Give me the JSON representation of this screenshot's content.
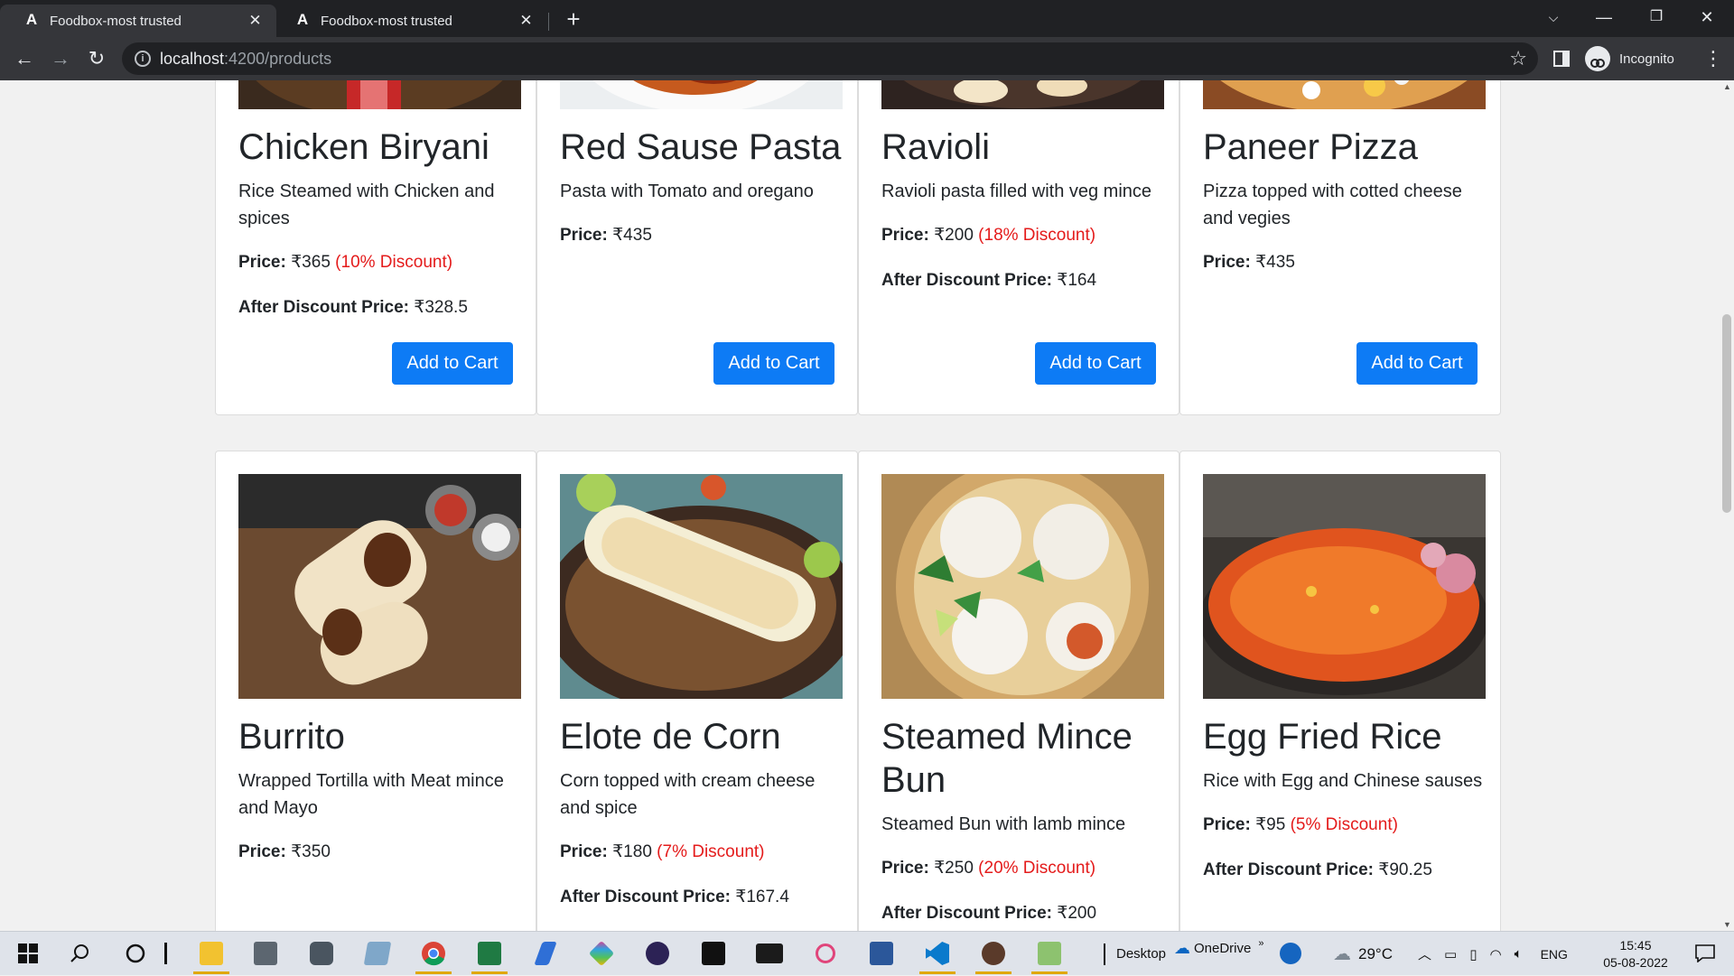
{
  "browser": {
    "tabs": [
      {
        "favicon": "A",
        "title": "Foodbox-most trusted",
        "active": true
      },
      {
        "favicon": "A",
        "title": "Foodbox-most trusted",
        "active": false
      }
    ],
    "new_tab": "+",
    "url_host": "localhost",
    "url_rest": ":4200/products",
    "profile_label": "Incognito",
    "icons": {
      "back": "back-arrow-icon",
      "forward": "forward-arrow-icon",
      "reload": "reload-icon",
      "star": "bookmark-star-icon",
      "menu": "kebab-menu-icon"
    }
  },
  "products": [
    {
      "name": "Chicken Biryani",
      "desc": "Rice Steamed with Chicken and spices",
      "price_label": "Price:",
      "price": "₹365",
      "discount": "(10% Discount)",
      "after_label": "After Discount Price:",
      "after_price": "₹328.5",
      "button": "Add to Cart"
    },
    {
      "name": "Red Sause Pasta",
      "desc": "Pasta with Tomato and oregano",
      "price_label": "Price:",
      "price": "₹435",
      "button": "Add to Cart"
    },
    {
      "name": "Ravioli",
      "desc": "Ravioli pasta filled with veg mince",
      "price_label": "Price:",
      "price": "₹200",
      "discount": "(18% Discount)",
      "after_label": "After Discount Price:",
      "after_price": "₹164",
      "button": "Add to Cart"
    },
    {
      "name": "Paneer Pizza",
      "desc": "Pizza topped with cotted cheese and vegies",
      "price_label": "Price:",
      "price": "₹435",
      "button": "Add to Cart"
    },
    {
      "name": "Burrito",
      "desc": "Wrapped Tortilla with Meat mince and Mayo",
      "price_label": "Price:",
      "price": "₹350"
    },
    {
      "name": "Elote de Corn",
      "desc": "Corn topped with cream cheese and spice",
      "price_label": "Price:",
      "price": "₹180",
      "discount": "(7% Discount)",
      "after_label": "After Discount Price:",
      "after_price": "₹167.4"
    },
    {
      "name": "Steamed Mince Bun",
      "desc": "Steamed Bun with lamb mince",
      "price_label": "Price:",
      "price": "₹250",
      "discount": "(20% Discount)",
      "after_label": "After Discount Price:",
      "after_price": "₹200"
    },
    {
      "name": "Egg Fried Rice",
      "desc": "Rice with Egg and Chinese sauses",
      "price_label": "Price:",
      "price": "₹95",
      "discount": "(5% Discount)",
      "after_label": "After Discount Price:",
      "after_price": "₹90.25"
    }
  ],
  "taskbar": {
    "desktop_label": "Desktop",
    "onedrive_label": "OneDrive",
    "temperature": "29°C",
    "language": "ENG",
    "time": "15:45",
    "date": "05-08-2022"
  },
  "colors": {
    "accent": "#0d7bf5",
    "discount": "#e41b1b"
  }
}
